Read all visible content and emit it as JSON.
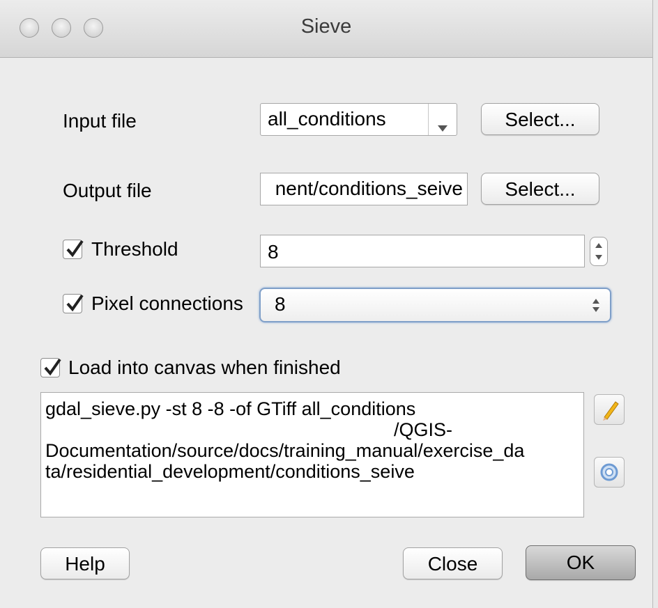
{
  "window": {
    "title": "Sieve"
  },
  "input": {
    "label": "Input file",
    "value": "all_conditions",
    "select_label": "Select..."
  },
  "output": {
    "label": "Output file",
    "value": "nent/conditions_seive",
    "select_label": "Select..."
  },
  "threshold": {
    "label": "Threshold",
    "checked": true,
    "value": "8"
  },
  "pixel_connections": {
    "label": "Pixel connections",
    "checked": true,
    "value": "8"
  },
  "load_canvas": {
    "label": "Load into canvas when finished",
    "checked": true
  },
  "command": {
    "line1": "gdal_sieve.py -st 8 -8 -of GTiff all_conditions",
    "line2_visible": "/QGIS-",
    "line3": "Documentation/source/docs/training_manual/exercise_da",
    "line4": "ta/residential_development/conditions_seive"
  },
  "buttons": {
    "help": "Help",
    "close": "Close",
    "ok": "OK"
  },
  "icons": {
    "edit": "pencil-icon",
    "reset": "reset-icon"
  }
}
